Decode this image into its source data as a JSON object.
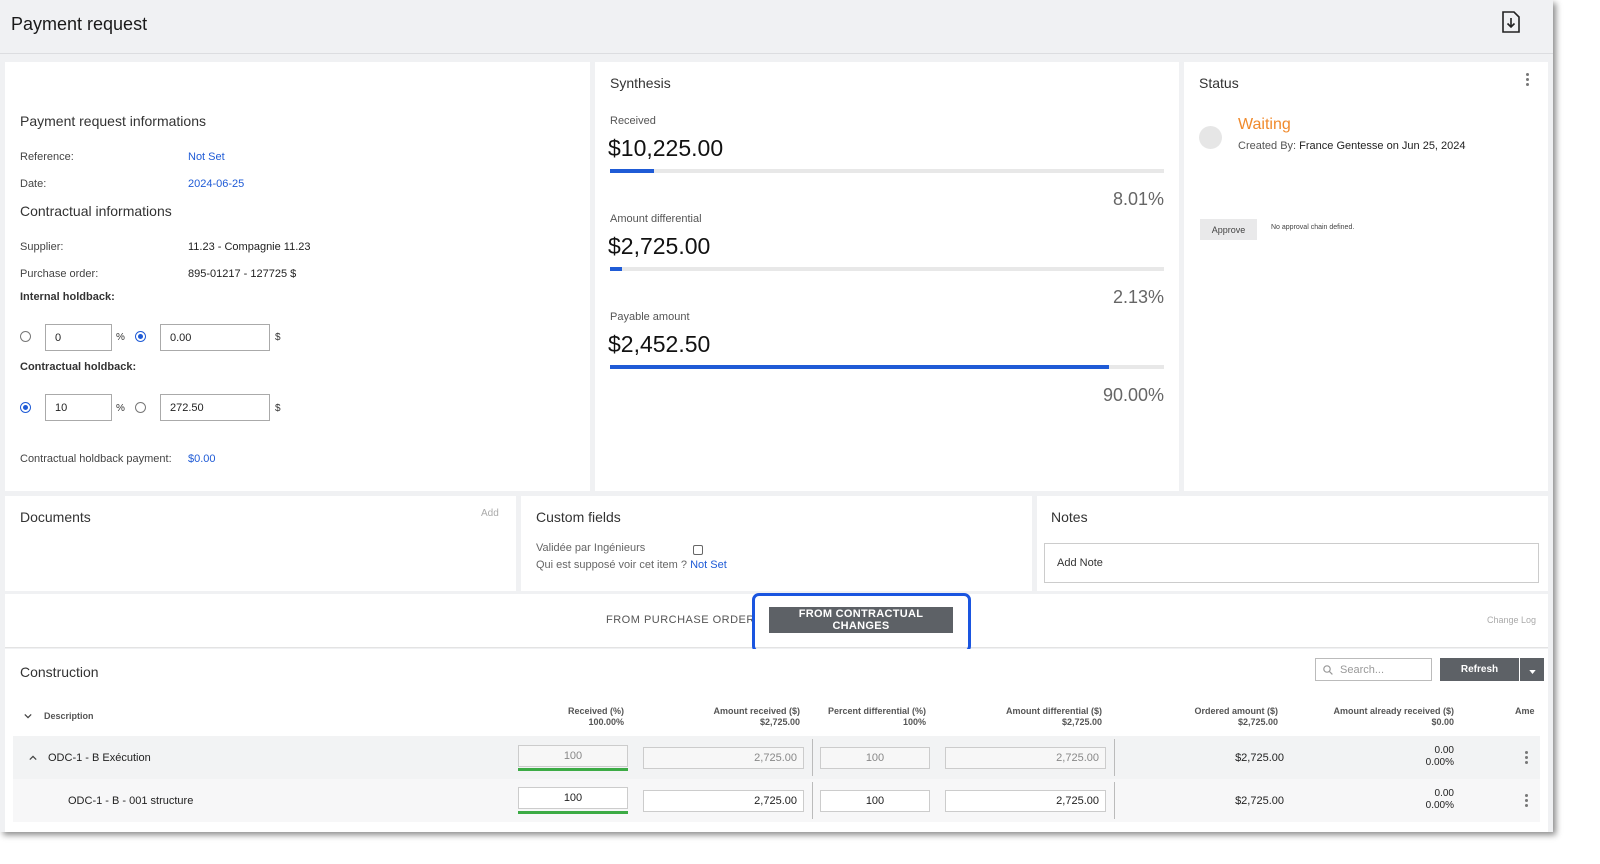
{
  "header": {
    "title": "Payment request",
    "export_icon": "export-download-icon"
  },
  "info": {
    "section_title": "Payment request informations",
    "reference_label": "Reference:",
    "reference_value": "Not Set",
    "date_label": "Date:",
    "date_value": "2024-06-25",
    "contractual_title": "Contractual informations",
    "supplier_label": "Supplier:",
    "supplier_value": "11.23 - Compagnie 11.23",
    "po_label": "Purchase order:",
    "po_value": "895-01217 - 127725 $",
    "internal_holdback_label": "Internal holdback:",
    "internal_pct_value": "0",
    "internal_amt_value": "0.00",
    "contractual_holdback_label": "Contractual holdback:",
    "contractual_pct_value": "10",
    "contractual_amt_value": "272.50",
    "pct_unit": "%",
    "dollar_unit": "$",
    "holdback_payment_label": "Contractual holdback payment:",
    "holdback_payment_value": "$0.00"
  },
  "synthesis": {
    "title": "Synthesis",
    "received_label": "Received",
    "received_value": "$10,225.00",
    "received_pct": "8.01%",
    "received_fraction": 0.0801,
    "diff_label": "Amount differential",
    "diff_value": "$2,725.00",
    "diff_pct": "2.13%",
    "diff_fraction": 0.0213,
    "payable_label": "Payable amount",
    "payable_value": "$2,452.50",
    "payable_pct": "90.00%",
    "payable_fraction": 0.9
  },
  "status": {
    "title": "Status",
    "state": "Waiting",
    "created_prefix": "Created By:",
    "created_by": "France Gentesse",
    "created_on_prefix": "on",
    "created_date": "Jun 25, 2024",
    "approve_label": "Approve",
    "no_chain": "No approval chain defined."
  },
  "documents": {
    "title": "Documents",
    "add_label": "Add"
  },
  "custom_fields": {
    "title": "Custom fields",
    "field1_label": "Validée par Ingénieurs",
    "field2_label": "Qui est supposé voir cet item ?",
    "field2_value": "Not Set"
  },
  "notes": {
    "title": "Notes",
    "add_note_placeholder": "Add Note"
  },
  "tabs": {
    "from_po": "FROM PURCHASE ORDER",
    "from_cc": "FROM CONTRACTUAL CHANGES",
    "change_log": "Change Log"
  },
  "construction": {
    "title": "Construction",
    "search_placeholder": "Search...",
    "refresh_label": "Refresh",
    "columns": {
      "description": "Description",
      "received_pct": "Received (%)",
      "received_pct_total": "100.00%",
      "amount_received": "Amount received ($)",
      "amount_received_total": "$2,725.00",
      "percent_diff": "Percent differential (%)",
      "percent_diff_total": "100%",
      "amount_diff": "Amount differential ($)",
      "amount_diff_total": "$2,725.00",
      "ordered": "Ordered amount ($)",
      "ordered_total": "$2,725.00",
      "already_received": "Amount already received ($)",
      "already_received_total": "$0.00",
      "truncated": "Ame"
    },
    "rows": [
      {
        "description": "ODC-1 - B Exécution",
        "received_pct": "100",
        "amount_received": "2,725.00",
        "percent_diff": "100",
        "amount_diff": "2,725.00",
        "ordered": "$2,725.00",
        "already_amt": "0.00",
        "already_pct": "0.00%"
      },
      {
        "description": "ODC-1 - B - 001 structure",
        "received_pct": "100",
        "amount_received": "2,725.00",
        "percent_diff": "100",
        "amount_diff": "2,725.00",
        "ordered": "$2,725.00",
        "already_amt": "0.00",
        "already_pct": "0.00%"
      }
    ]
  }
}
